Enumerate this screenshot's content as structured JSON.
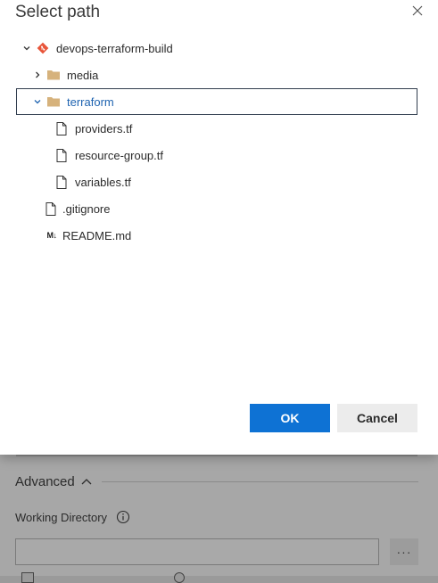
{
  "dialog": {
    "title": "Select path",
    "ok_label": "OK",
    "cancel_label": "Cancel"
  },
  "tree": {
    "items": [
      {
        "label": "devops-terraform-build",
        "type": "repo",
        "expanded": true
      },
      {
        "label": "media",
        "type": "folder",
        "expanded": false
      },
      {
        "label": "terraform",
        "type": "folder",
        "expanded": true,
        "selected": true
      },
      {
        "label": "providers.tf",
        "type": "file"
      },
      {
        "label": "resource-group.tf",
        "type": "file"
      },
      {
        "label": "variables.tf",
        "type": "file"
      },
      {
        "label": ".gitignore",
        "type": "file"
      },
      {
        "label": "README.md",
        "type": "markdown",
        "icon_text": "M↓"
      }
    ]
  },
  "background": {
    "advanced_label": "Advanced",
    "working_directory_label": "Working Directory",
    "working_directory_value": "",
    "browse_label": "···"
  },
  "colors": {
    "primary": "#0e72d4",
    "selected_text": "#1e63b0",
    "folder": "#d6b27c",
    "repo": "#e8553a"
  }
}
